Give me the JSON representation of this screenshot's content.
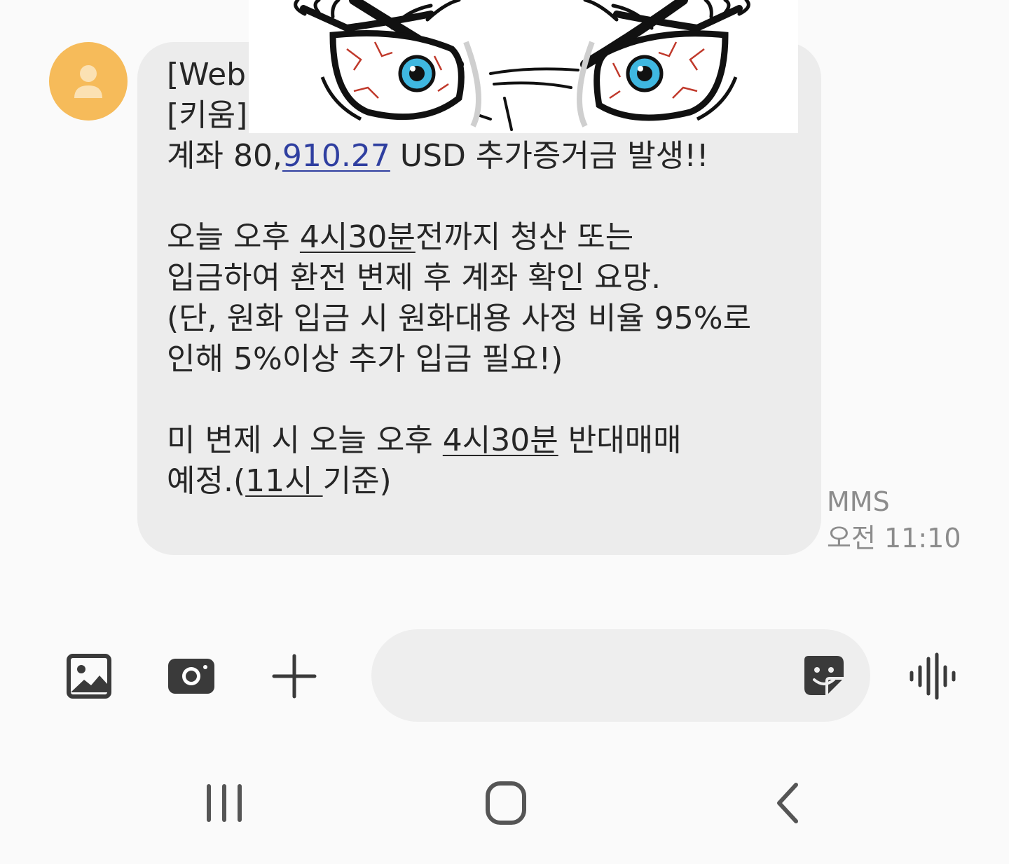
{
  "conversation": {
    "message": {
      "line1_prefix": "[Web",
      "line2_prefix": "[키움]",
      "line3_a": "계좌 80,",
      "line3_link": "910.27",
      "line3_b": " USD 추가증거금 발생!!",
      "line4_a": "오늘 오후 ",
      "line4_u": "4시30분",
      "line4_b": "전까지 청산 또는",
      "line5": "입금하여 환전 변제 후 계좌 확인 요망.",
      "line6": "(단, 원화 입금 시 원화대용 사정 비율 95%로",
      "line7": "인해 5%이상 추가 입금 필요!)",
      "line8_a": "미 변제 시 오늘 오후 ",
      "line8_u": "4시30분",
      "line8_b": " 반대매매",
      "line9_a": "예정.(",
      "line9_u": "11시 ",
      "line9_b": "기준)"
    },
    "meta": {
      "type": "MMS",
      "time": "오전 11:10"
    }
  },
  "composer": {
    "input_value": "",
    "input_placeholder": ""
  },
  "icons": {
    "avatar": "person-icon",
    "gallery": "image-icon",
    "camera": "camera-icon",
    "add": "plus-icon",
    "sticker": "sticker-icon",
    "voice": "voice-wave-icon",
    "nav_recents": "recents-icon",
    "nav_home": "home-icon",
    "nav_back": "back-icon"
  },
  "colors": {
    "avatar_bg": "#f6bb5a",
    "bubble_bg": "#ececec",
    "link": "#2f3fa0",
    "meta_text": "#8c8c8c"
  }
}
